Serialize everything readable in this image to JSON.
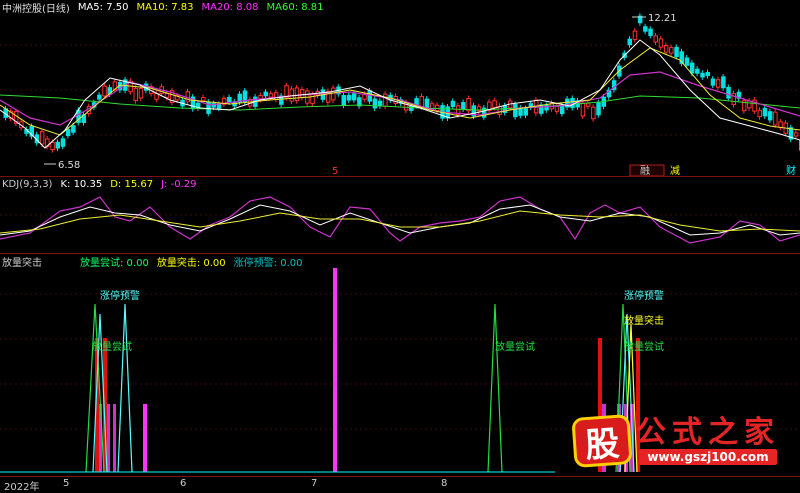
{
  "main": {
    "title": "中洲控股(日线)",
    "ma": [
      {
        "label": "MA5: 7.50",
        "color": "#ffffff"
      },
      {
        "label": "MA10: 7.83",
        "color": "#ffff00"
      },
      {
        "label": "MA20: 8.08",
        "color": "#ff00ff"
      },
      {
        "label": "MA60: 8.81",
        "color": "#00ff00"
      }
    ],
    "high_label": "12.21",
    "low_label": "6.58",
    "event_labels": [
      {
        "text": "5",
        "color": "#ff3030"
      },
      {
        "text": "融",
        "color": "#cccccc"
      },
      {
        "text": "减",
        "color": "#ffff00"
      },
      {
        "text": "财",
        "color": "#00ffff"
      }
    ]
  },
  "kdj": {
    "title": "KDJ(9,3,3)",
    "k": "K: 10.35",
    "d": "D: 15.67",
    "j": "J: -0.29"
  },
  "volume": {
    "title": "放量突击",
    "legend": [
      {
        "label": "放量尝试: 0.00",
        "color": "#00ff66"
      },
      {
        "label": "放量突击: 0.00",
        "color": "#ffff00"
      },
      {
        "label": "涨停预警: 0.00",
        "color": "#00c0c0"
      }
    ],
    "annotations": [
      {
        "text": "涨停预警",
        "color": "#55ffff"
      },
      {
        "text": "放量尝试",
        "color": "#22dd44"
      },
      {
        "text": "放量尝试",
        "color": "#22dd44"
      },
      {
        "text": "涨停预警",
        "color": "#55ffff"
      },
      {
        "text": "放量突击",
        "color": "#ffff33"
      },
      {
        "text": "放量尝试",
        "color": "#22dd44"
      }
    ]
  },
  "axis": {
    "labels": [
      "2022年",
      "5",
      "6",
      "7",
      "8"
    ]
  },
  "logo": {
    "glyph": "股",
    "name": "公式之家",
    "url": "www.gszj100.com"
  }
}
